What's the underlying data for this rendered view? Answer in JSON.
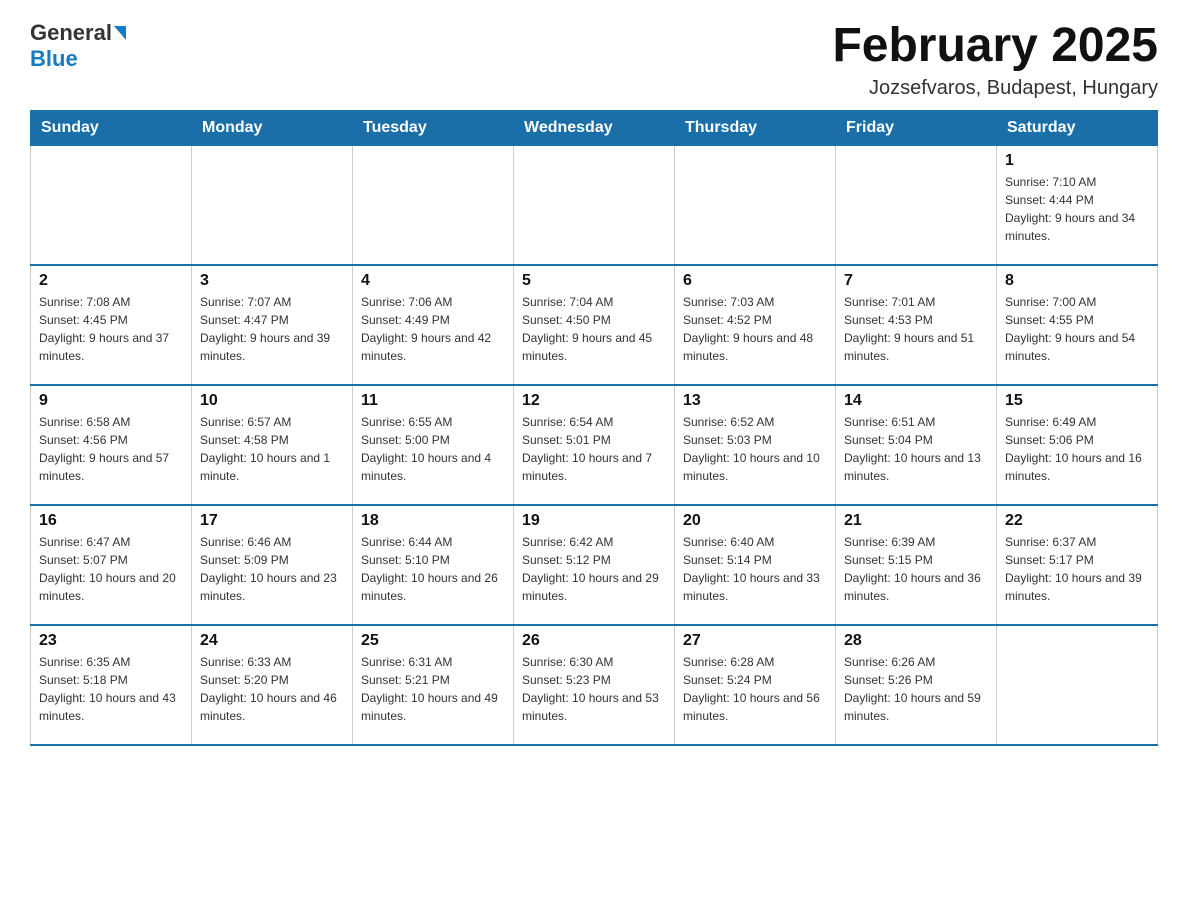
{
  "logo": {
    "general": "General",
    "blue": "Blue"
  },
  "header": {
    "title": "February 2025",
    "subtitle": "Jozsefvaros, Budapest, Hungary"
  },
  "days_of_week": [
    "Sunday",
    "Monday",
    "Tuesday",
    "Wednesday",
    "Thursday",
    "Friday",
    "Saturday"
  ],
  "weeks": [
    [
      {
        "day": "",
        "sunrise": "",
        "sunset": "",
        "daylight": ""
      },
      {
        "day": "",
        "sunrise": "",
        "sunset": "",
        "daylight": ""
      },
      {
        "day": "",
        "sunrise": "",
        "sunset": "",
        "daylight": ""
      },
      {
        "day": "",
        "sunrise": "",
        "sunset": "",
        "daylight": ""
      },
      {
        "day": "",
        "sunrise": "",
        "sunset": "",
        "daylight": ""
      },
      {
        "day": "",
        "sunrise": "",
        "sunset": "",
        "daylight": ""
      },
      {
        "day": "1",
        "sunrise": "Sunrise: 7:10 AM",
        "sunset": "Sunset: 4:44 PM",
        "daylight": "Daylight: 9 hours and 34 minutes."
      }
    ],
    [
      {
        "day": "2",
        "sunrise": "Sunrise: 7:08 AM",
        "sunset": "Sunset: 4:45 PM",
        "daylight": "Daylight: 9 hours and 37 minutes."
      },
      {
        "day": "3",
        "sunrise": "Sunrise: 7:07 AM",
        "sunset": "Sunset: 4:47 PM",
        "daylight": "Daylight: 9 hours and 39 minutes."
      },
      {
        "day": "4",
        "sunrise": "Sunrise: 7:06 AM",
        "sunset": "Sunset: 4:49 PM",
        "daylight": "Daylight: 9 hours and 42 minutes."
      },
      {
        "day": "5",
        "sunrise": "Sunrise: 7:04 AM",
        "sunset": "Sunset: 4:50 PM",
        "daylight": "Daylight: 9 hours and 45 minutes."
      },
      {
        "day": "6",
        "sunrise": "Sunrise: 7:03 AM",
        "sunset": "Sunset: 4:52 PM",
        "daylight": "Daylight: 9 hours and 48 minutes."
      },
      {
        "day": "7",
        "sunrise": "Sunrise: 7:01 AM",
        "sunset": "Sunset: 4:53 PM",
        "daylight": "Daylight: 9 hours and 51 minutes."
      },
      {
        "day": "8",
        "sunrise": "Sunrise: 7:00 AM",
        "sunset": "Sunset: 4:55 PM",
        "daylight": "Daylight: 9 hours and 54 minutes."
      }
    ],
    [
      {
        "day": "9",
        "sunrise": "Sunrise: 6:58 AM",
        "sunset": "Sunset: 4:56 PM",
        "daylight": "Daylight: 9 hours and 57 minutes."
      },
      {
        "day": "10",
        "sunrise": "Sunrise: 6:57 AM",
        "sunset": "Sunset: 4:58 PM",
        "daylight": "Daylight: 10 hours and 1 minute."
      },
      {
        "day": "11",
        "sunrise": "Sunrise: 6:55 AM",
        "sunset": "Sunset: 5:00 PM",
        "daylight": "Daylight: 10 hours and 4 minutes."
      },
      {
        "day": "12",
        "sunrise": "Sunrise: 6:54 AM",
        "sunset": "Sunset: 5:01 PM",
        "daylight": "Daylight: 10 hours and 7 minutes."
      },
      {
        "day": "13",
        "sunrise": "Sunrise: 6:52 AM",
        "sunset": "Sunset: 5:03 PM",
        "daylight": "Daylight: 10 hours and 10 minutes."
      },
      {
        "day": "14",
        "sunrise": "Sunrise: 6:51 AM",
        "sunset": "Sunset: 5:04 PM",
        "daylight": "Daylight: 10 hours and 13 minutes."
      },
      {
        "day": "15",
        "sunrise": "Sunrise: 6:49 AM",
        "sunset": "Sunset: 5:06 PM",
        "daylight": "Daylight: 10 hours and 16 minutes."
      }
    ],
    [
      {
        "day": "16",
        "sunrise": "Sunrise: 6:47 AM",
        "sunset": "Sunset: 5:07 PM",
        "daylight": "Daylight: 10 hours and 20 minutes."
      },
      {
        "day": "17",
        "sunrise": "Sunrise: 6:46 AM",
        "sunset": "Sunset: 5:09 PM",
        "daylight": "Daylight: 10 hours and 23 minutes."
      },
      {
        "day": "18",
        "sunrise": "Sunrise: 6:44 AM",
        "sunset": "Sunset: 5:10 PM",
        "daylight": "Daylight: 10 hours and 26 minutes."
      },
      {
        "day": "19",
        "sunrise": "Sunrise: 6:42 AM",
        "sunset": "Sunset: 5:12 PM",
        "daylight": "Daylight: 10 hours and 29 minutes."
      },
      {
        "day": "20",
        "sunrise": "Sunrise: 6:40 AM",
        "sunset": "Sunset: 5:14 PM",
        "daylight": "Daylight: 10 hours and 33 minutes."
      },
      {
        "day": "21",
        "sunrise": "Sunrise: 6:39 AM",
        "sunset": "Sunset: 5:15 PM",
        "daylight": "Daylight: 10 hours and 36 minutes."
      },
      {
        "day": "22",
        "sunrise": "Sunrise: 6:37 AM",
        "sunset": "Sunset: 5:17 PM",
        "daylight": "Daylight: 10 hours and 39 minutes."
      }
    ],
    [
      {
        "day": "23",
        "sunrise": "Sunrise: 6:35 AM",
        "sunset": "Sunset: 5:18 PM",
        "daylight": "Daylight: 10 hours and 43 minutes."
      },
      {
        "day": "24",
        "sunrise": "Sunrise: 6:33 AM",
        "sunset": "Sunset: 5:20 PM",
        "daylight": "Daylight: 10 hours and 46 minutes."
      },
      {
        "day": "25",
        "sunrise": "Sunrise: 6:31 AM",
        "sunset": "Sunset: 5:21 PM",
        "daylight": "Daylight: 10 hours and 49 minutes."
      },
      {
        "day": "26",
        "sunrise": "Sunrise: 6:30 AM",
        "sunset": "Sunset: 5:23 PM",
        "daylight": "Daylight: 10 hours and 53 minutes."
      },
      {
        "day": "27",
        "sunrise": "Sunrise: 6:28 AM",
        "sunset": "Sunset: 5:24 PM",
        "daylight": "Daylight: 10 hours and 56 minutes."
      },
      {
        "day": "28",
        "sunrise": "Sunrise: 6:26 AM",
        "sunset": "Sunset: 5:26 PM",
        "daylight": "Daylight: 10 hours and 59 minutes."
      },
      {
        "day": "",
        "sunrise": "",
        "sunset": "",
        "daylight": ""
      }
    ]
  ]
}
